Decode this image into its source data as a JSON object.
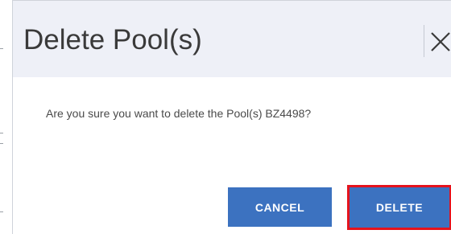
{
  "dialog": {
    "title": "Delete Pool(s)",
    "close_icon": "close-x-icon",
    "message": "Are you sure you want to delete the Pool(s) BZ4498?",
    "buttons": {
      "cancel_label": "CANCEL",
      "delete_label": "DELETE"
    }
  },
  "colors": {
    "header_background": "#eef0f7",
    "button_primary": "#3c72c0",
    "highlight_outline": "#e5131d"
  }
}
